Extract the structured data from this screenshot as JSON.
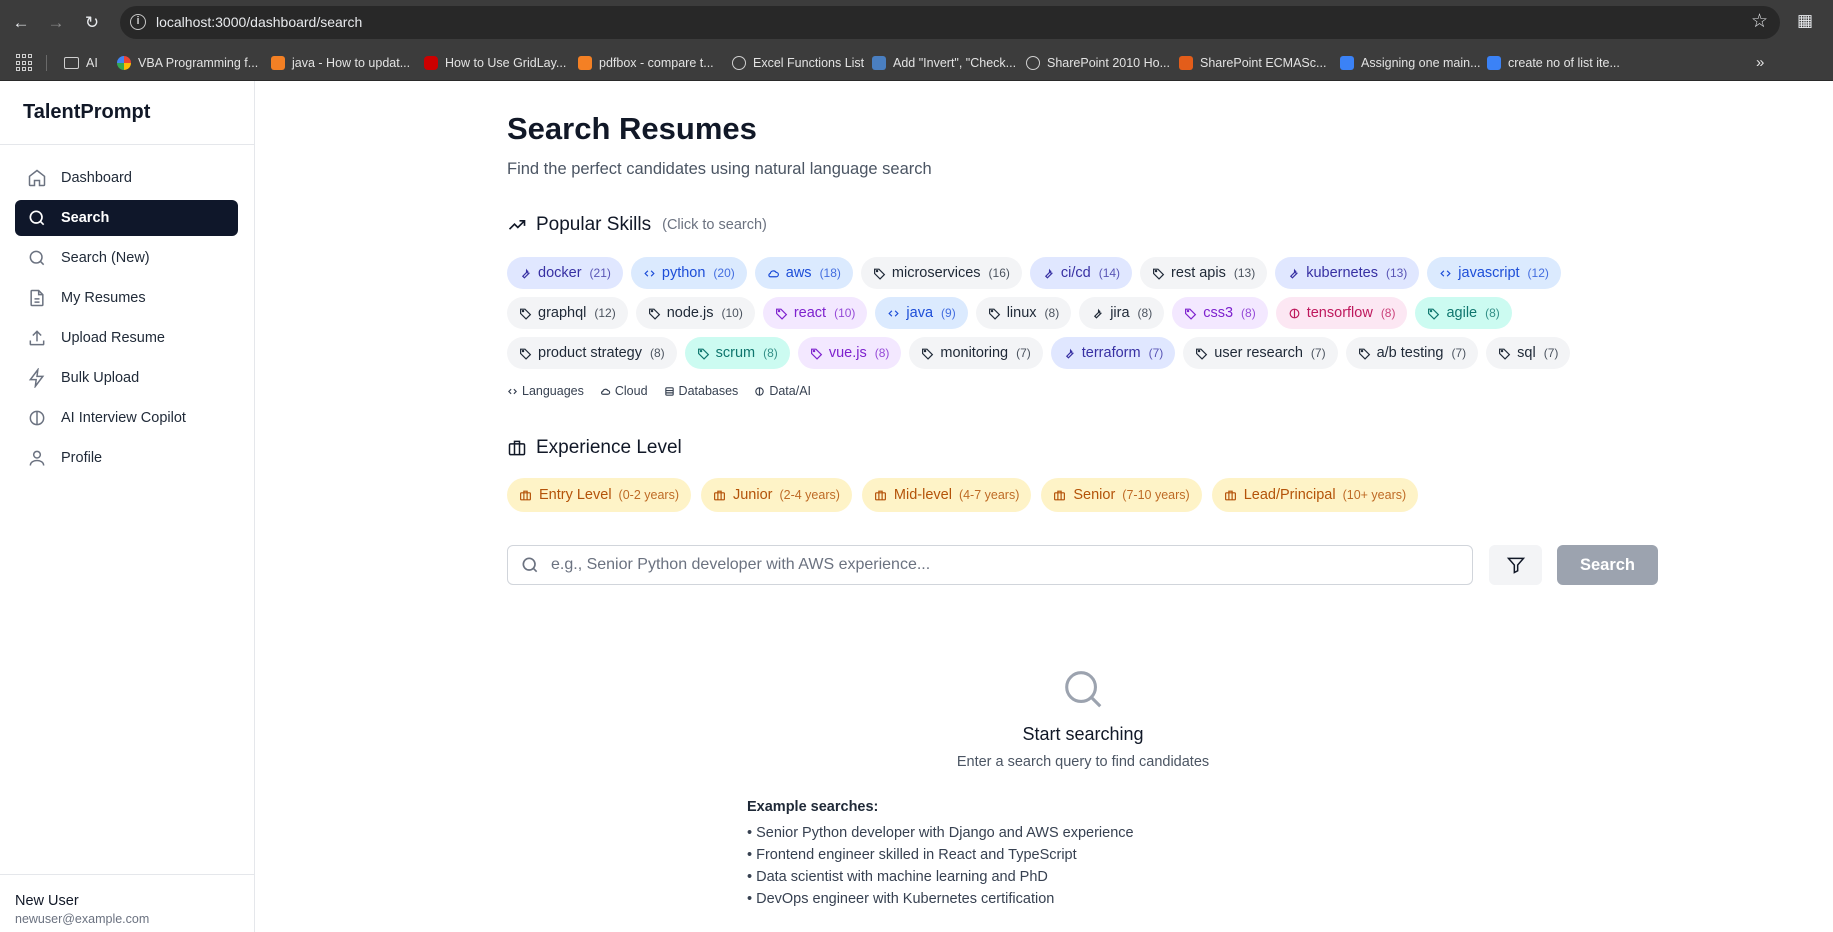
{
  "browser": {
    "url": "localhost:3000/dashboard/search",
    "bookmarks": [
      "AI",
      "VBA Programming f...",
      "java - How to updat...",
      "How to Use GridLay...",
      "pdfbox - compare t...",
      "Excel Functions List",
      "Add \"Invert\", \"Check...",
      "SharePoint 2010 Ho...",
      "SharePoint ECMASc...",
      "Assigning one main...",
      "create no of list ite..."
    ],
    "more": "»"
  },
  "sidebar": {
    "brand": "TalentPrompt",
    "items": [
      {
        "label": "Dashboard"
      },
      {
        "label": "Search"
      },
      {
        "label": "Search (New)"
      },
      {
        "label": "My Resumes"
      },
      {
        "label": "Upload Resume"
      },
      {
        "label": "Bulk Upload"
      },
      {
        "label": "AI Interview Copilot"
      },
      {
        "label": "Profile"
      }
    ],
    "user": {
      "name": "New User",
      "email": "newuser@example.com"
    }
  },
  "main": {
    "title": "Search Resumes",
    "subtitle": "Find the perfect candidates using natural language search",
    "popular": {
      "title": "Popular Skills",
      "hint": "(Click to search)",
      "skills": [
        {
          "name": "docker",
          "count": "(21)"
        },
        {
          "name": "python",
          "count": "(20)"
        },
        {
          "name": "aws",
          "count": "(18)"
        },
        {
          "name": "microservices",
          "count": "(16)"
        },
        {
          "name": "ci/cd",
          "count": "(14)"
        },
        {
          "name": "rest apis",
          "count": "(13)"
        },
        {
          "name": "kubernetes",
          "count": "(13)"
        },
        {
          "name": "javascript",
          "count": "(12)"
        },
        {
          "name": "graphql",
          "count": "(12)"
        },
        {
          "name": "node.js",
          "count": "(10)"
        },
        {
          "name": "react",
          "count": "(10)"
        },
        {
          "name": "java",
          "count": "(9)"
        },
        {
          "name": "linux",
          "count": "(8)"
        },
        {
          "name": "jira",
          "count": "(8)"
        },
        {
          "name": "css3",
          "count": "(8)"
        },
        {
          "name": "tensorflow",
          "count": "(8)"
        },
        {
          "name": "agile",
          "count": "(8)"
        },
        {
          "name": "product strategy",
          "count": "(8)"
        },
        {
          "name": "scrum",
          "count": "(8)"
        },
        {
          "name": "vue.js",
          "count": "(8)"
        },
        {
          "name": "monitoring",
          "count": "(7)"
        },
        {
          "name": "terraform",
          "count": "(7)"
        },
        {
          "name": "user research",
          "count": "(7)"
        },
        {
          "name": "a/b testing",
          "count": "(7)"
        },
        {
          "name": "sql",
          "count": "(7)"
        }
      ],
      "legend": [
        "Languages",
        "Cloud",
        "Databases",
        "Data/AI"
      ]
    },
    "experience": {
      "title": "Experience Level",
      "levels": [
        {
          "label": "Entry Level",
          "range": "(0-2 years)"
        },
        {
          "label": "Junior",
          "range": "(2-4 years)"
        },
        {
          "label": "Mid-level",
          "range": "(4-7 years)"
        },
        {
          "label": "Senior",
          "range": "(7-10 years)"
        },
        {
          "label": "Lead/Principal",
          "range": "(10+ years)"
        }
      ]
    },
    "search": {
      "placeholder": "e.g., Senior Python developer with AWS experience...",
      "button": "Search"
    },
    "empty": {
      "title": "Start searching",
      "subtitle": "Enter a search query to find candidates",
      "examples_title": "Example searches:",
      "examples": [
        "• Senior Python developer with Django and AWS experience",
        "• Frontend engineer skilled in React and TypeScript",
        "• Data scientist with machine learning and PhD",
        "• DevOps engineer with Kubernetes certification"
      ]
    }
  }
}
